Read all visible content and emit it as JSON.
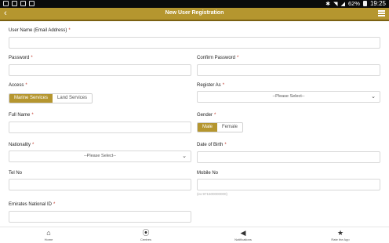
{
  "status_bar": {
    "battery": "62%",
    "time": "19:25"
  },
  "app_bar": {
    "title": "New User Registration"
  },
  "form": {
    "user_name": {
      "label": "User Name (Email Address)",
      "required": "*"
    },
    "password": {
      "label": "Password",
      "required": "*"
    },
    "confirm_password": {
      "label": "Confirm Password",
      "required": "*"
    },
    "access": {
      "label": "Access",
      "required": "*",
      "options": [
        "Marine Services",
        "Land Services"
      ],
      "selected": "Marine Services"
    },
    "register_as": {
      "label": "Register As",
      "required": "*",
      "value": "--Please Select--"
    },
    "full_name": {
      "label": "Full Name",
      "required": "*"
    },
    "gender": {
      "label": "Gender",
      "required": "*",
      "options": [
        "Male",
        "Female"
      ],
      "selected": "Male"
    },
    "nationality": {
      "label": "Nationality",
      "required": "*",
      "value": "--Please Select--"
    },
    "date_of_birth": {
      "label": "Date of Birth",
      "required": "*"
    },
    "tel_no": {
      "label": "Tel No"
    },
    "mobile_no": {
      "label": "Mobile No",
      "hint": "(ex:971500000000)"
    },
    "emirates_id": {
      "label": "Emirates National ID",
      "required": "*"
    }
  },
  "bottom_nav": {
    "items": [
      {
        "label": "Home",
        "icon": "home-icon"
      },
      {
        "label": "Centres",
        "icon": "location-pin-icon"
      },
      {
        "label": "Notifications",
        "icon": "megaphone-icon"
      },
      {
        "label": "Rate the App",
        "icon": "star-icon"
      }
    ]
  },
  "colors": {
    "accent": "#b5962f",
    "accent_dark": "#7b6112",
    "required": "#c0392b"
  }
}
